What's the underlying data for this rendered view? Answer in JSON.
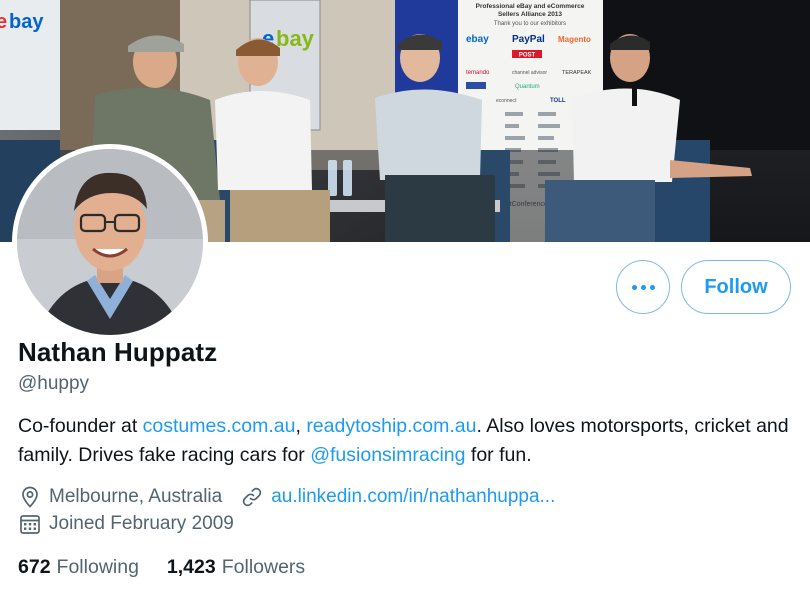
{
  "profile": {
    "name": "Nathan Huppatz",
    "handle": "@huppy",
    "bio": {
      "part1": "Co-founder at ",
      "link1": "costumes.com.au",
      "sep": ", ",
      "link2": "readytoship.com.au",
      "part2": ". Also loves motorsports, cricket and family. Drives fake racing cars for ",
      "mention": "@fusionsimracing",
      "part3": " for fun."
    },
    "location": "Melbourne, Australia",
    "website": "au.linkedin.com/in/nathanhuppa...",
    "joined": "Joined February 2009"
  },
  "stats": {
    "following_count": "672",
    "following_label": "Following",
    "followers_count": "1,423",
    "followers_label": "Followers"
  },
  "actions": {
    "follow_label": "Follow",
    "more_icon": "more-dots-icon"
  },
  "banner": {
    "sponsor_board_title": "Professional eBay and eCommerce Sellers Alliance 2013",
    "sponsor_board_thanks": "Thank you to our exhibitors",
    "sponsors": [
      "ebay",
      "PayPal",
      "Magento",
      "POST",
      "Temando",
      "channel advisor",
      "TERAPEAK",
      "eDEAL",
      "Quantum",
      "TOLL",
      "econnect"
    ],
    "screen_logo": "ebay",
    "left_screen_logo": "ebay",
    "board_footer": "netConference"
  },
  "icons": {
    "location": "location-pin-icon",
    "link": "link-icon",
    "calendar": "calendar-icon"
  },
  "colors": {
    "accent": "#1d9bf0",
    "text": "#0f1419",
    "secondary": "#536471",
    "border": "#7fb9e8"
  }
}
